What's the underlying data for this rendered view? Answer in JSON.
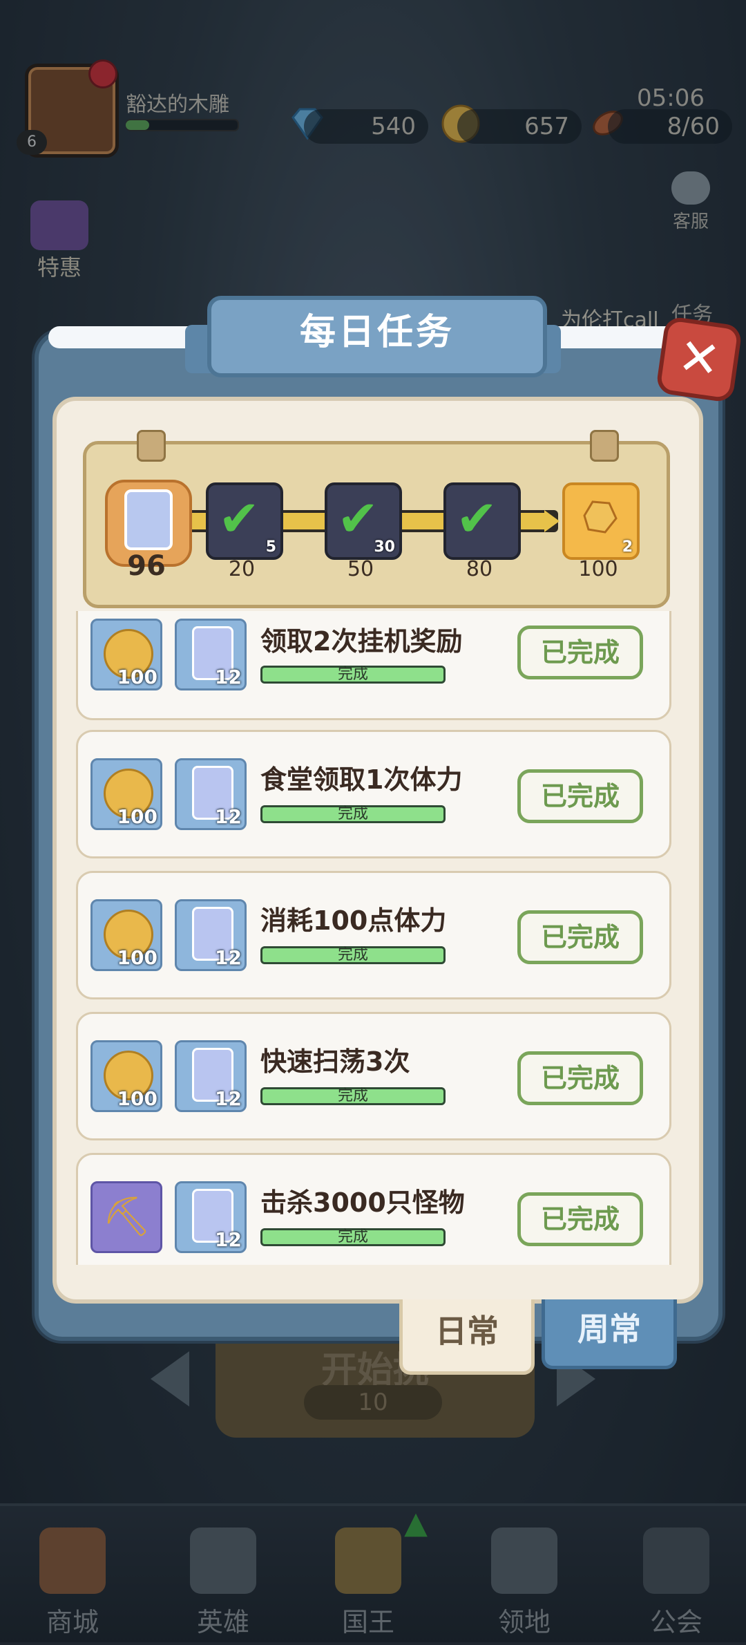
{
  "player": {
    "name": "豁达的木雕",
    "level": "6",
    "xp_progress": 0.2
  },
  "resources": {
    "gems": "540",
    "coins": "657",
    "time": "05:06",
    "stamina": "8/60"
  },
  "side_buttons": {
    "customer_service": "客服",
    "special_offer": "特惠",
    "tasks_partial": "任务",
    "call_text": "为伦打call"
  },
  "panel": {
    "title": "每日任务",
    "close_label": "✕"
  },
  "progress": {
    "current_score": "96",
    "milestones": [
      {
        "label": "20",
        "count": "5",
        "claimed": true
      },
      {
        "label": "50",
        "count": "30",
        "claimed": true
      },
      {
        "label": "80",
        "count": "",
        "claimed": true
      },
      {
        "label": "100",
        "count": "2",
        "claimed": false
      }
    ]
  },
  "tasks": [
    {
      "name": "领取2次挂机奖励",
      "reward1": "100",
      "reward2": "12",
      "bar": "完成",
      "button": "已完成",
      "icon1": "coin-icon"
    },
    {
      "name": "食堂领取1次体力",
      "reward1": "100",
      "reward2": "12",
      "bar": "完成",
      "button": "已完成",
      "icon1": "coin-icon"
    },
    {
      "name": "消耗100点体力",
      "reward1": "100",
      "reward2": "12",
      "bar": "完成",
      "button": "已完成",
      "icon1": "coin-icon"
    },
    {
      "name": "快速扫荡3次",
      "reward1": "100",
      "reward2": "12",
      "bar": "完成",
      "button": "已完成",
      "icon1": "coin-icon"
    },
    {
      "name": "击杀3000只怪物",
      "reward1": "",
      "reward2": "12",
      "bar": "完成",
      "button": "已完成",
      "icon1": "pickaxe-icon"
    }
  ],
  "tabs": {
    "daily": "日常",
    "weekly": "周常"
  },
  "start": {
    "label": "开始挑",
    "cost": "10"
  },
  "nav": {
    "shop": "商城",
    "heroes": "英雄",
    "king": "国王",
    "territory": "领地",
    "guild": "公会"
  },
  "colors": {
    "accent_blue": "#5f8fb7",
    "done_green": "#7aa55a",
    "bar_green": "#8ee08b",
    "panel_cream": "#f3ede1"
  }
}
